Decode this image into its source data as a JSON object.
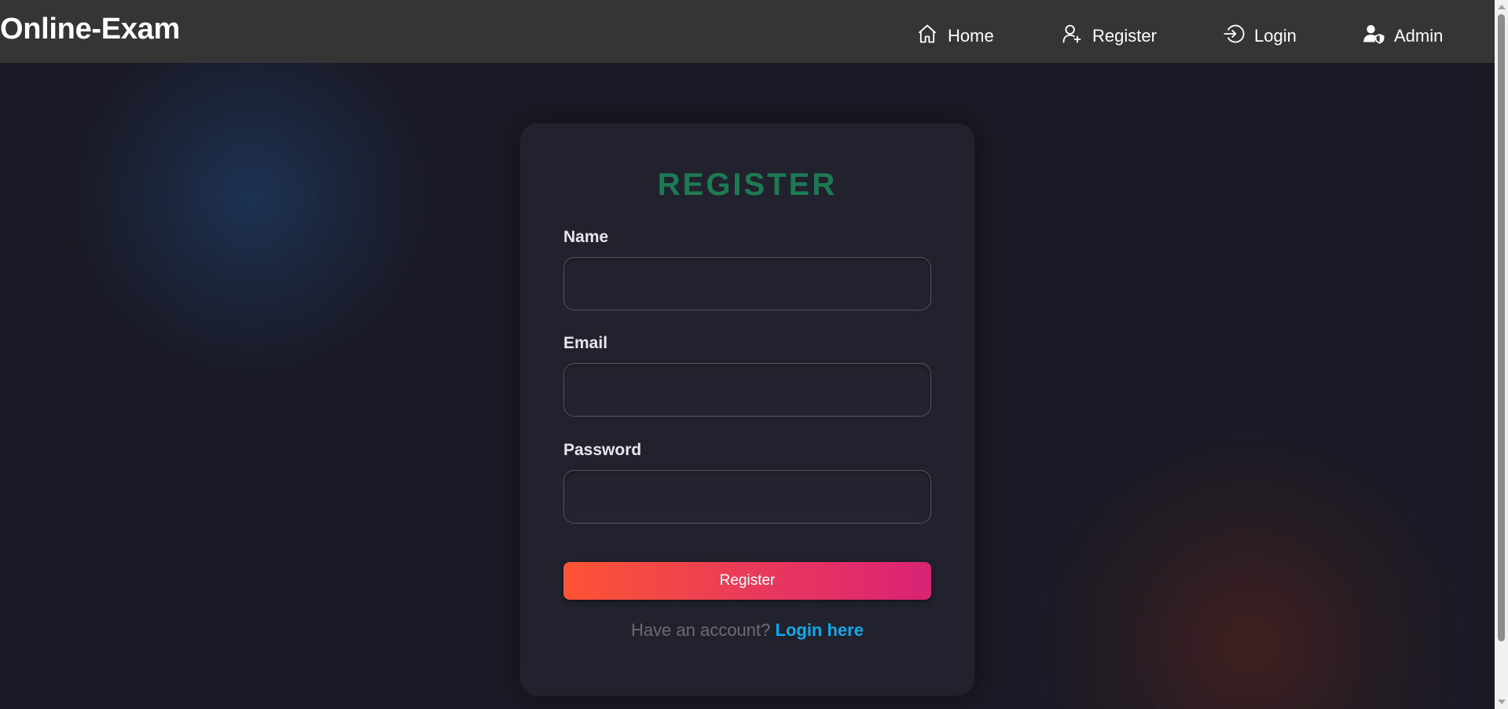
{
  "navbar": {
    "brand": "Online-Exam",
    "items": [
      {
        "label": "Home",
        "icon": "home-icon"
      },
      {
        "label": "Register",
        "icon": "user-add-icon"
      },
      {
        "label": "Login",
        "icon": "login-icon"
      },
      {
        "label": "Admin",
        "icon": "user-shield-icon"
      }
    ]
  },
  "form": {
    "title": "REGISTER",
    "fields": [
      {
        "label": "Name",
        "value": "",
        "placeholder": ""
      },
      {
        "label": "Email",
        "value": "",
        "placeholder": ""
      },
      {
        "label": "Password",
        "value": "",
        "placeholder": ""
      }
    ],
    "submit_label": "Register",
    "login_prompt": "Have an account?",
    "login_link": "Login here"
  },
  "colors": {
    "title_green": "#1e7a52",
    "button_gradient_start": "#fd5434",
    "button_gradient_end": "#d92375",
    "link_blue": "#14a9e6",
    "navbar_bg": "#353535",
    "card_bg": "#22222e"
  }
}
